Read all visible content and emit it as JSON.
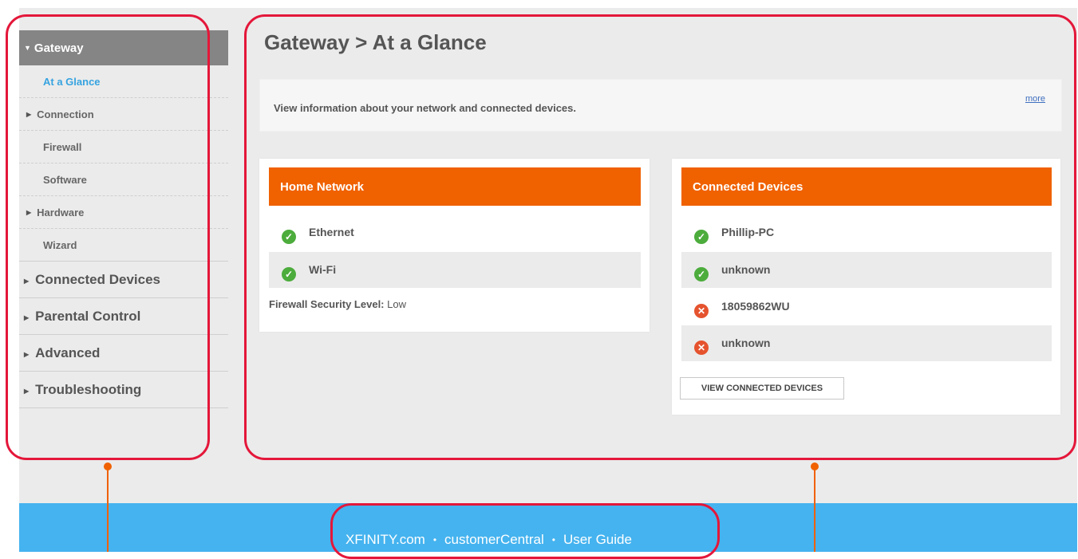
{
  "sidebar": {
    "header": "Gateway",
    "subitems": [
      {
        "label": "At a Glance"
      },
      {
        "label": "Connection"
      },
      {
        "label": "Firewall"
      },
      {
        "label": "Software"
      },
      {
        "label": "Hardware"
      },
      {
        "label": "Wizard"
      }
    ],
    "main": [
      {
        "label": "Connected Devices"
      },
      {
        "label": "Parental Control"
      },
      {
        "label": "Advanced"
      },
      {
        "label": "Troubleshooting"
      }
    ]
  },
  "main": {
    "title": "Gateway > At a Glance",
    "info": "View information about your network and connected devices.",
    "more": "more"
  },
  "home_network": {
    "title": "Home Network",
    "rows": [
      {
        "label": "Ethernet",
        "status": "ok"
      },
      {
        "label": "Wi-Fi",
        "status": "ok"
      }
    ],
    "firewall_label": "Firewall Security Level:",
    "firewall_value": "Low"
  },
  "connected_devices": {
    "title": "Connected Devices",
    "rows": [
      {
        "label": "Phillip-PC",
        "status": "ok"
      },
      {
        "label": "unknown",
        "status": "ok"
      },
      {
        "label": "18059862WU",
        "status": "offline"
      },
      {
        "label": "unknown",
        "status": "offline"
      }
    ],
    "button": "VIEW CONNECTED DEVICES"
  },
  "footer": {
    "links": [
      {
        "label": "XFINITY.com"
      },
      {
        "label": "customerCentral"
      },
      {
        "label": "User Guide"
      }
    ],
    "separator": "•"
  },
  "colors": {
    "accent_orange": "#f06100",
    "footer_blue": "#45b3ef",
    "active_link": "#36a3e0",
    "annotation_red": "#e4173a",
    "ok_green": "#4cac3c",
    "error_red": "#e5532e"
  },
  "icons": {
    "ok": "check-circle-icon",
    "offline": "x-circle-icon"
  }
}
